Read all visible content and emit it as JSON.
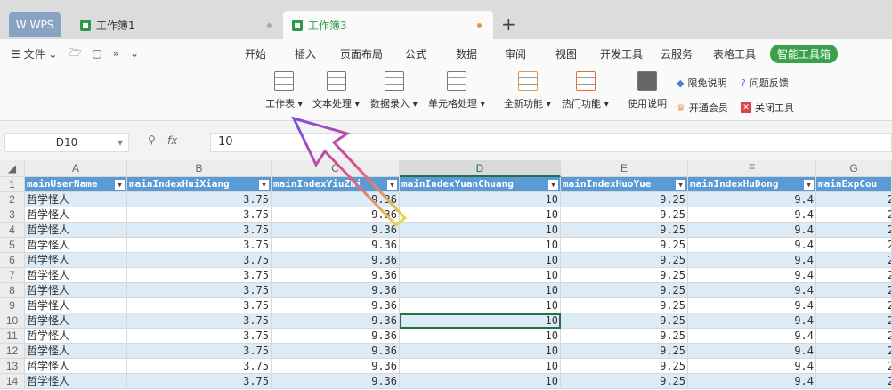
{
  "tabs": {
    "app": "WPS",
    "docs": [
      {
        "label": "工作簿1"
      },
      {
        "label": "工作簿3"
      }
    ]
  },
  "menu": {
    "file": "文件",
    "tabs": [
      "开始",
      "插入",
      "页面布局",
      "公式",
      "数据",
      "审阅",
      "视图",
      "开发工具",
      "云服务",
      "表格工具",
      "智能工具箱"
    ]
  },
  "ribbon": {
    "buttons": [
      "工作表",
      "文本处理",
      "数据录入",
      "单元格处理",
      "全新功能",
      "热门功能",
      "使用说明"
    ],
    "small": [
      "限免说明",
      "问题反馈",
      "开通会员",
      "关闭工具"
    ]
  },
  "formula": {
    "cell_ref": "D10",
    "fx": "fx",
    "value": "10"
  },
  "grid": {
    "columns": [
      "A",
      "B",
      "C",
      "D",
      "E",
      "F",
      "G"
    ],
    "headers": [
      "mainUserName",
      "mainIndexHuiXiang",
      "mainIndexYiuZhi",
      "mainIndexYuanChuang",
      "mainIndexHuoYue",
      "mainIndexHuDong",
      "mainExpCou"
    ],
    "rows": [
      [
        "哲学怪人",
        "3.75",
        "9.36",
        "10",
        "9.25",
        "9.4",
        "2"
      ],
      [
        "哲学怪人",
        "3.75",
        "9.36",
        "10",
        "9.25",
        "9.4",
        "2"
      ],
      [
        "哲学怪人",
        "3.75",
        "9.36",
        "10",
        "9.25",
        "9.4",
        "2"
      ],
      [
        "哲学怪人",
        "3.75",
        "9.36",
        "10",
        "9.25",
        "9.4",
        "2"
      ],
      [
        "哲学怪人",
        "3.75",
        "9.36",
        "10",
        "9.25",
        "9.4",
        "2"
      ],
      [
        "哲学怪人",
        "3.75",
        "9.36",
        "10",
        "9.25",
        "9.4",
        "2"
      ],
      [
        "哲学怪人",
        "3.75",
        "9.36",
        "10",
        "9.25",
        "9.4",
        "2"
      ],
      [
        "哲学怪人",
        "3.75",
        "9.36",
        "10",
        "9.25",
        "9.4",
        "2"
      ],
      [
        "哲学怪人",
        "3.75",
        "9.36",
        "10",
        "9.25",
        "9.4",
        "2"
      ],
      [
        "哲学怪人",
        "3.75",
        "9.36",
        "10",
        "9.25",
        "9.4",
        "2"
      ],
      [
        "哲学怪人",
        "3.75",
        "9.36",
        "10",
        "9.25",
        "9.4",
        "2"
      ],
      [
        "哲学怪人",
        "3.75",
        "9.36",
        "10",
        "9.25",
        "9.4",
        "2"
      ],
      [
        "哲学怪人",
        "3.75",
        "9.36",
        "10",
        "9.25",
        "9.4",
        "2"
      ]
    ],
    "selected": "D10",
    "colors": {
      "header": "#5b9bd5",
      "band": "#ddebf7",
      "selection": "#217346"
    }
  }
}
